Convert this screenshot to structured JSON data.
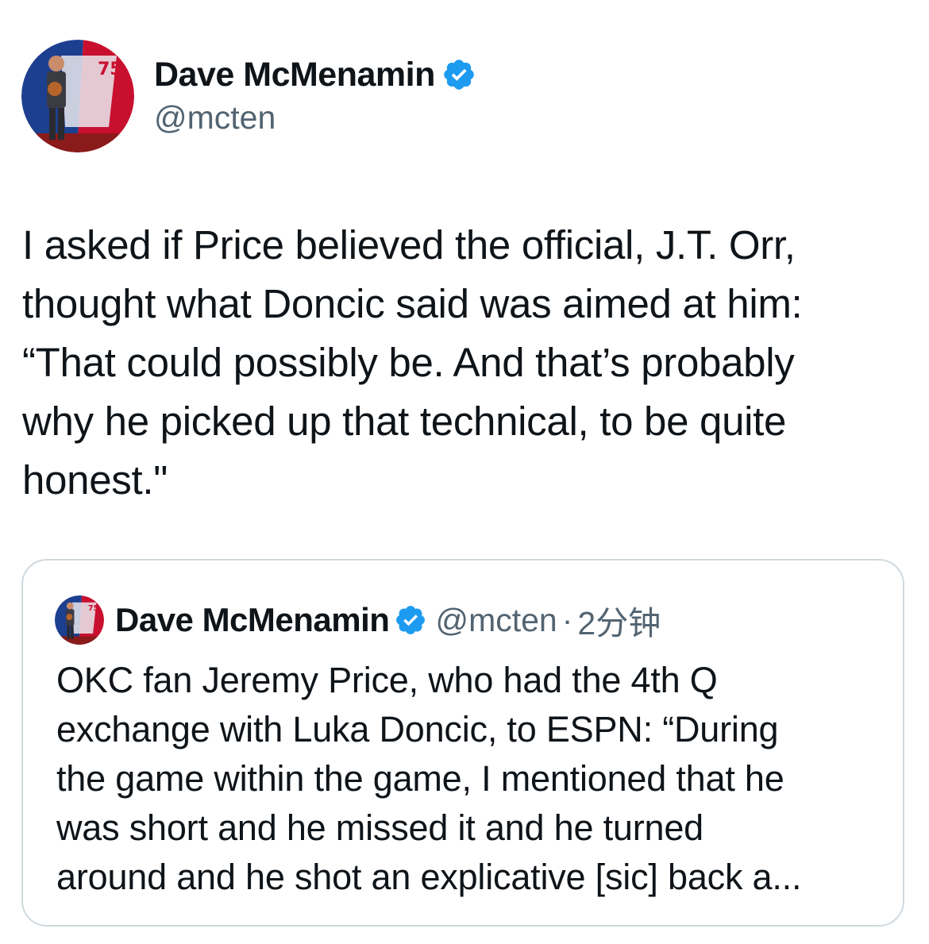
{
  "author": {
    "display_name": "Dave McMenamin",
    "handle": "@mcten",
    "verified": true,
    "avatar_icon": "profile-photo-nba75-backdrop"
  },
  "tweet": {
    "text": "I asked if Price believed the official, J.T. Orr,\nthought what Doncic said was aimed at him:\n“That could possibly be. And that’s probably\nwhy he picked up that technical, to be quite\nhonest.\""
  },
  "quoted_tweet": {
    "display_name": "Dave McMenamin",
    "handle": "@mcten",
    "separator": "·",
    "time": "2分钟",
    "verified": true,
    "text": "OKC fan Jeremy Price, who had the 4th Q\nexchange with Luka Doncic, to ESPN: “During\nthe game within the game, I mentioned that he\nwas short and he missed it and he turned\naround and he shot an explicative [sic] back a..."
  },
  "colors": {
    "text_primary": "#0f1419",
    "text_secondary": "#536471",
    "verified_blue": "#1d9bf0",
    "card_border": "#cfd9de"
  }
}
